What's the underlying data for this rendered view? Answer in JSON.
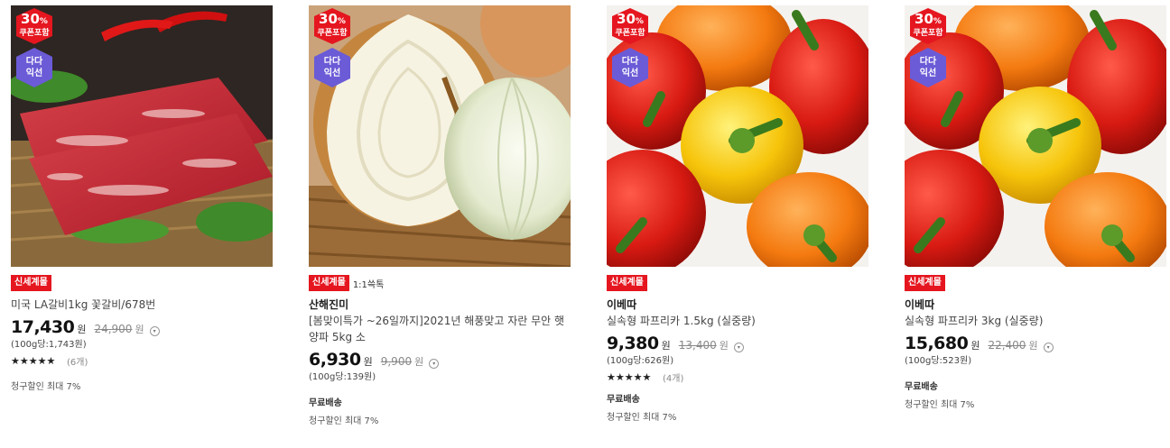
{
  "colors": {
    "coupon_badge": "#e5161f",
    "dada_badge": "#6b5bd6",
    "tag_red": "#e5161f"
  },
  "badges": {
    "coupon_percent": "30",
    "coupon_percent_sign": "%",
    "coupon_label": "쿠폰포함",
    "dada_line1": "다다",
    "dada_line2": "익선"
  },
  "icons": {
    "info": "info-circle-icon",
    "star": "star-icon"
  },
  "products": [
    {
      "image": "beef-ribs",
      "tag": "신세계몰",
      "extra_tag": "",
      "brand": "",
      "name": "미국 LA갈비1kg 꽃갈비/678번",
      "price": "17,430",
      "currency": "원",
      "original_price": "24,900",
      "unit_price": "(100g당:1,743원)",
      "rating": 4.5,
      "review_count": "(6개)",
      "shipping": "",
      "discount_text": "청구할인 최대 7%"
    },
    {
      "image": "onion",
      "tag": "신세계몰",
      "extra_tag": "1:1쓱톡",
      "brand": "산해진미",
      "name": "[봄맞이특가 ~26일까지]2021년 해풍맞고 자란 무안 햇양파 5kg 소",
      "price": "6,930",
      "currency": "원",
      "original_price": "9,900",
      "unit_price": "(100g당:139원)",
      "rating": null,
      "review_count": "",
      "shipping": "무료배송",
      "discount_text": "청구할인 최대 7%"
    },
    {
      "image": "paprika",
      "tag": "신세계몰",
      "extra_tag": "",
      "brand": "이베따",
      "name": "실속형 파프리카 1.5kg (실중량)",
      "price": "9,380",
      "currency": "원",
      "original_price": "13,400",
      "unit_price": "(100g당:626원)",
      "rating": 5,
      "review_count": "(4개)",
      "shipping": "무료배송",
      "discount_text": "청구할인 최대 7%"
    },
    {
      "image": "paprika",
      "tag": "신세계몰",
      "extra_tag": "",
      "brand": "이베따",
      "name": "실속형 파프리카 3kg (실중량)",
      "price": "15,680",
      "currency": "원",
      "original_price": "22,400",
      "unit_price": "(100g당:523원)",
      "rating": null,
      "review_count": "",
      "shipping": "무료배송",
      "discount_text": "청구할인 최대 7%"
    }
  ]
}
